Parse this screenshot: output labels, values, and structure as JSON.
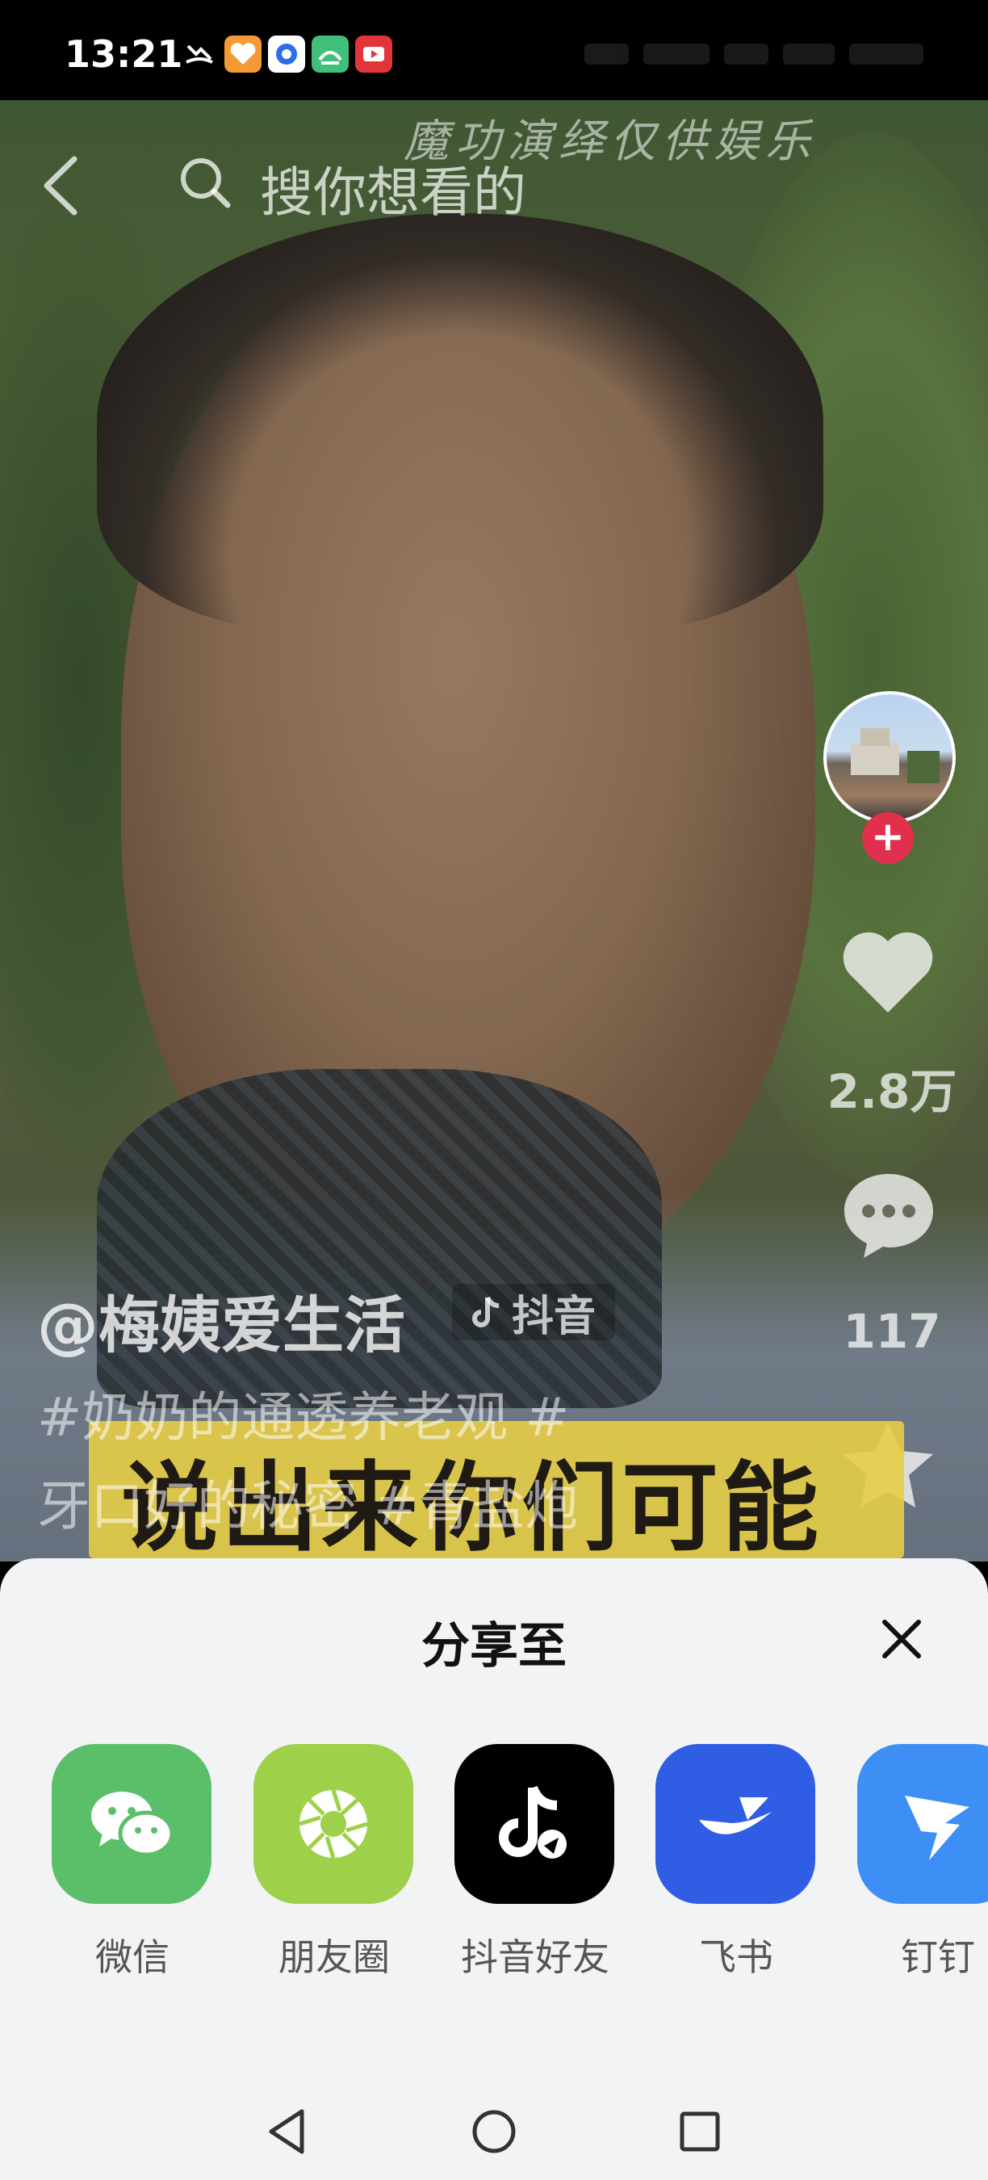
{
  "status_bar": {
    "time": "13:21"
  },
  "top_bar": {
    "search_placeholder": "搜你想看的"
  },
  "video": {
    "watermark": "魔功演绎仅供娱乐",
    "subtitle": "说出来你们可能",
    "author": "@梅姨爱生活",
    "platform_tag": "抖音",
    "caption_line1": "#奶奶的通透养老观 #",
    "caption_line2": "牙口好的秘密 #青盐炮"
  },
  "right_rail": {
    "like_count": "2.8万",
    "comment_count": "117"
  },
  "share_sheet": {
    "title": "分享至",
    "targets": [
      {
        "label": "微信",
        "icon": "wechat-icon",
        "color": "#5bbf6a"
      },
      {
        "label": "朋友圈",
        "icon": "moments-icon",
        "color": "#9fd04a"
      },
      {
        "label": "抖音好友",
        "icon": "douyin-icon",
        "color": "#000000"
      },
      {
        "label": "飞书",
        "icon": "feishu-icon",
        "color": "#2f5de4"
      },
      {
        "label": "钉钉",
        "icon": "dingtalk-icon",
        "color": "#3d8ff5"
      }
    ]
  },
  "colors": {
    "follow_badge": "#e0304e",
    "sheet_bg": "#f2f3f5"
  }
}
